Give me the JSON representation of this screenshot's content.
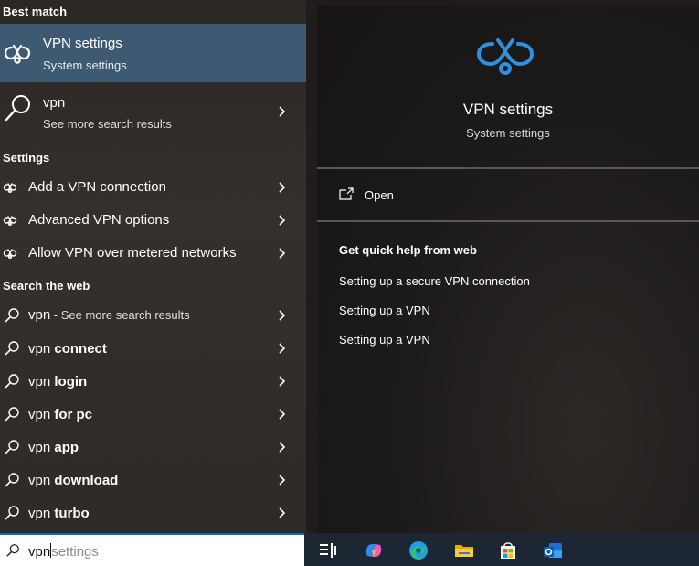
{
  "sections": {
    "best_match": "Best match",
    "settings": "Settings",
    "search_web": "Search the web"
  },
  "best_match": {
    "title": "VPN settings",
    "subtitle": "System settings"
  },
  "vpn_result": {
    "title": "vpn",
    "subtitle": "See more search results"
  },
  "settings_items": [
    "Add a VPN connection",
    "Advanced VPN options",
    "Allow VPN over metered networks"
  ],
  "web_items": [
    {
      "prefix": "vpn",
      "suffix": " - See more search results"
    },
    {
      "prefix": "vpn ",
      "bold": "connect"
    },
    {
      "prefix": "vpn ",
      "bold": "login"
    },
    {
      "prefix": "vpn ",
      "bold": "for pc"
    },
    {
      "prefix": "vpn ",
      "bold": "app"
    },
    {
      "prefix": "vpn ",
      "bold": "download"
    },
    {
      "prefix": "vpn ",
      "bold": "turbo"
    }
  ],
  "search": {
    "typed": "vpn",
    "ghost": "settings"
  },
  "preview": {
    "title": "VPN settings",
    "subtitle": "System settings",
    "open_label": "Open",
    "help_header": "Get quick help from web",
    "help_links": [
      "Setting up a secure VPN connection",
      "Setting up a VPN",
      "Setting up a VPN"
    ]
  },
  "taskbar": [
    "task-view-icon",
    "copilot-icon",
    "edge-icon",
    "file-explorer-icon",
    "store-icon",
    "outlook-icon"
  ],
  "colors": {
    "accent": "#0078d4",
    "selection": "#3e5a72",
    "taskbar": "#1d2733"
  }
}
